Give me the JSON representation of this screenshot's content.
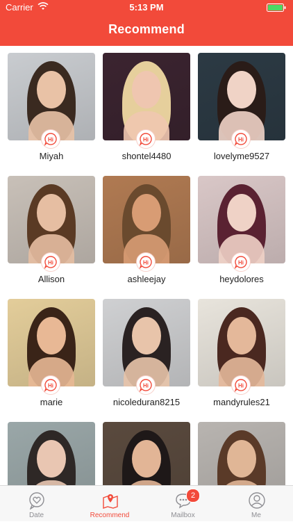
{
  "status_bar": {
    "carrier": "Carrier",
    "time": "5:13 PM"
  },
  "header": {
    "title": "Recommend"
  },
  "hi_label": "Hi",
  "profiles": [
    {
      "name": "Miyah",
      "bg": "#c9ccd0",
      "hair": "#3a2a20",
      "skin": "#e9c2a6"
    },
    {
      "name": "shontel4480",
      "bg": "#3b2430",
      "hair": "#e6cf9c",
      "skin": "#efc6b0"
    },
    {
      "name": "lovelyme9527",
      "bg": "#2c3a44",
      "hair": "#2a1c18",
      "skin": "#f0d3c6"
    },
    {
      "name": "Allison",
      "bg": "#c8c0b8",
      "hair": "#5a3a24",
      "skin": "#e6bea2"
    },
    {
      "name": "ashleejay",
      "bg": "#b07a52",
      "hair": "#6a4a2e",
      "skin": "#d89c74"
    },
    {
      "name": "heydolores",
      "bg": "#d9c7c7",
      "hair": "#5a2232",
      "skin": "#efd2c6"
    },
    {
      "name": "marie",
      "bg": "#e3cd9a",
      "hair": "#3a2418",
      "skin": "#e8b895"
    },
    {
      "name": "nicoleduran8215",
      "bg": "#cfd0d2",
      "hair": "#2a2222",
      "skin": "#e8c4aa"
    },
    {
      "name": "mandyrules21",
      "bg": "#e8e4dc",
      "hair": "#4a2820",
      "skin": "#e4b89a"
    },
    {
      "name": "",
      "bg": "#9aa7a8",
      "hair": "#2e2826",
      "skin": "#e9c6b2"
    },
    {
      "name": "",
      "bg": "#5a4a3e",
      "hair": "#1e1818",
      "skin": "#e2b596"
    },
    {
      "name": "",
      "bg": "#b8b4b0",
      "hair": "#5a3a28",
      "skin": "#e0b696"
    }
  ],
  "tabs": [
    {
      "label": "Date",
      "icon": "heart-chat-icon",
      "active": false
    },
    {
      "label": "Recommend",
      "icon": "map-pin-icon",
      "active": true
    },
    {
      "label": "Mailbox",
      "icon": "chat-bubble-icon",
      "active": false,
      "badge": "2"
    },
    {
      "label": "Me",
      "icon": "person-icon",
      "active": false
    }
  ],
  "colors": {
    "brand": "#f24a3a",
    "inactive": "#8e8e93"
  }
}
